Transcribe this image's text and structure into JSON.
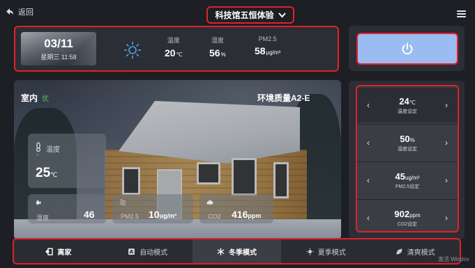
{
  "header": {
    "back_label": "返回",
    "title": "科技馆五恒体验"
  },
  "weather": {
    "date": "03/11",
    "weekday_time": "星期三 11:58",
    "temperature": {
      "label": "温度",
      "value": "20",
      "unit": "℃"
    },
    "humidity": {
      "label": "湿度",
      "value": "56",
      "unit": "%"
    },
    "pm25": {
      "label": "PM2.5",
      "value": "58",
      "unit": "μg/m³"
    }
  },
  "indoor": {
    "title": "室内",
    "status": "优",
    "quality_label": "环境质量A2-E",
    "temperature": {
      "label": "温度",
      "sub": "○",
      "value": "25",
      "unit": "℃"
    },
    "humidity": {
      "label": "湿度",
      "value": "46"
    },
    "pm25": {
      "label": "PM2.5",
      "value": "10",
      "unit": "ug/m³"
    },
    "co2": {
      "label": "CO2",
      "value": "416",
      "unit": "ppm"
    }
  },
  "settings": [
    {
      "value": "24",
      "unit": "℃",
      "name": "温度设定"
    },
    {
      "value": "50",
      "unit": "%",
      "name": "湿度设定"
    },
    {
      "value": "45",
      "unit": "ug/m³",
      "name": "PM2.5设定"
    },
    {
      "value": "902",
      "unit": "ppm",
      "name": "CO2设定"
    }
  ],
  "modes": [
    {
      "label": "离家"
    },
    {
      "label": "自动模式"
    },
    {
      "label": "冬季模式"
    },
    {
      "label": "夏季模式"
    },
    {
      "label": "清爽模式"
    }
  ],
  "watermark": "激活 Windov",
  "colors": {
    "accent_border": "#e3202b",
    "power_button": "#9bbcf1",
    "good_status": "#57c24f"
  }
}
